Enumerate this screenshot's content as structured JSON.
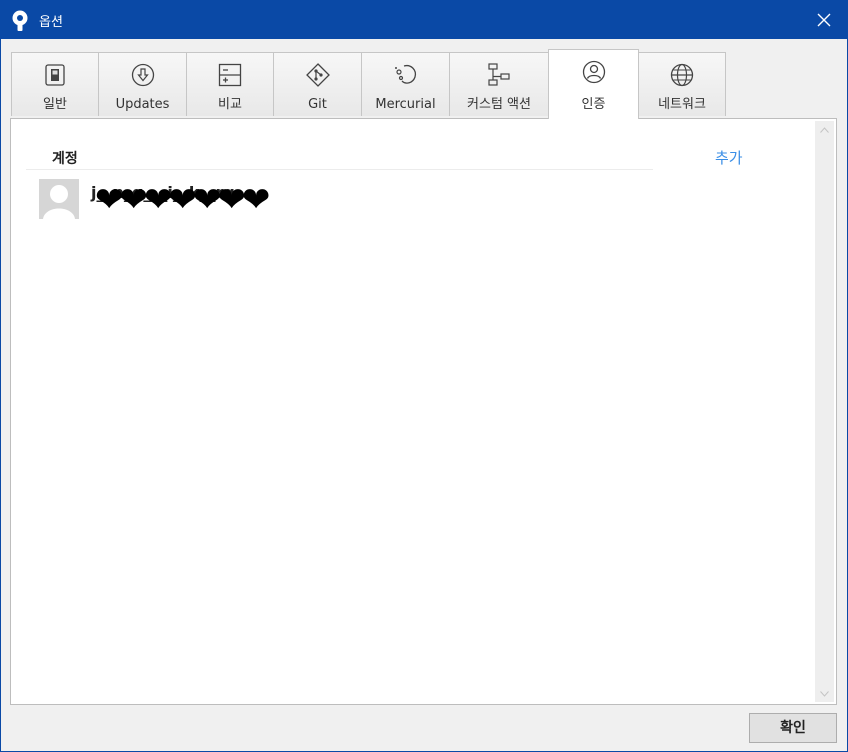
{
  "window": {
    "title": "옵션",
    "close_icon": "close-icon"
  },
  "tabs": [
    {
      "label": "일반",
      "icon": "switch-icon",
      "active": false
    },
    {
      "label": "Updates",
      "icon": "download-icon",
      "active": false
    },
    {
      "label": "비교",
      "icon": "diff-icon",
      "active": false
    },
    {
      "label": "Git",
      "icon": "git-icon",
      "active": false
    },
    {
      "label": "Mercurial",
      "icon": "mercurial-icon",
      "active": false
    },
    {
      "label": "커스텀 액션",
      "icon": "custom-action-icon",
      "active": false
    },
    {
      "label": "인증",
      "icon": "user-icon",
      "active": true
    },
    {
      "label": "네트워크",
      "icon": "globe-icon",
      "active": false
    }
  ],
  "auth": {
    "section_title": "계정",
    "add_label": "추가",
    "accounts": [
      {
        "name": "j__n_g___i__k__rg",
        "redaction": "❤❤❤❤❤❤❤"
      }
    ]
  },
  "footer": {
    "ok_label": "확인"
  },
  "colors": {
    "titlebar": "#0a49a6",
    "link": "#3a8ee6"
  }
}
